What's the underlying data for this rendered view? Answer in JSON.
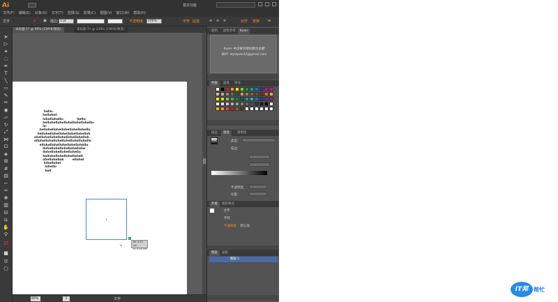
{
  "app": {
    "logo": "Ai",
    "menu": [
      "文件(F)",
      "编辑(E)",
      "对象(O)",
      "文字(T)",
      "选择(S)",
      "效果(C)",
      "视图(V)",
      "窗口(W)",
      "帮助(H)"
    ],
    "workspace": "基本功能"
  },
  "controlbar": {
    "tool_name": "文字",
    "stroke_value": "1 pt",
    "opacity_label": "不透明度:",
    "opacity_value": "100%",
    "char_label": "字符",
    "para_label": "段落",
    "transform_label": "对齐",
    "arrange_label": "变换"
  },
  "documents": {
    "tabs": [
      {
        "label": "未标题-1* @ 99% (CMYK/预览)",
        "active": true
      },
      {
        "label": "未标题-2* @ 249% (CMYK/预览)",
        "active": false
      }
    ]
  },
  "artwork": {
    "lines": [
      "           hello-",
      "          hellohel-",
      "          lohellohello-            hello-",
      "          hellohellohellohellohellohello-",
      "          lo-",
      "       hellohellohellohellohellohello",
      "     hellohellohellohellohellohelloh",
      "  ohellohellohellohellohellohelloh",
      "  ellohellohellohellohellohellohello",
      "       ellohellohellohellohellohello",
      "          llohellohellohellohellohe",
      "          llohellohellohellohello",
      "          hellohellohellohellohell",
      "          ohellohellok        ellohel",
      "           lohellohel",
      "            lohello",
      "            hell"
    ],
    "dimension_w": "W: 5.53 cm",
    "dimension_h": "H: 5.53 cm"
  },
  "statusbar": {
    "zoom": "99%",
    "page": "1",
    "mode": "文字"
  },
  "panels": {
    "kuler_tabs": [
      "颜色",
      "颜色参考",
      "Kuler"
    ],
    "kuler_line1": "Kuler 中没有可用的颜色主题",
    "kuler_line2": "帐户: stylepan12@gmail.com",
    "swatch_tabs": [
      "色板",
      "画笔",
      "符号"
    ],
    "gradient_tabs": [
      "描边",
      "渐变",
      "透明度"
    ],
    "gradient_type_label": "类型:",
    "gradient_stroke_label": "描边:",
    "opacity_label": "不透明度:",
    "position_label": "位置:",
    "appearance_tabs": [
      "外观",
      "图形样式"
    ],
    "appearance_rows": [
      "文字",
      "字符",
      "不透明度: 默认值"
    ],
    "appearance_default": "默认值",
    "layers_tabs": [
      "图层",
      "画板"
    ],
    "layer_name": "图层 1"
  },
  "swatches": [
    "#ffffff",
    "#000000",
    "#e3191c",
    "#f39a1b",
    "#f6e51b",
    "#8dc63f",
    "#00a14b",
    "#00a6a6",
    "#1b75bb",
    "#2e3192",
    "#92278f",
    "#ec008c",
    "#f7aec3",
    "#c7b299",
    "#998675",
    "#736357",
    "#534741",
    "#c69c6d",
    "#a67c52",
    "#8c6239",
    "#754c24",
    "#603813",
    "#f26522",
    "#fbb040",
    "#fff200",
    "#d7df23",
    "#8dc63f",
    "#39b54a",
    "#009444",
    "#006838",
    "#00a79d",
    "#27aae1",
    "#1c75bc",
    "#2b3990",
    "#662d91",
    "#9e1f63",
    "#ffffff",
    "#e6e6e6",
    "#cccccc",
    "#b3b3b3",
    "#999999",
    "#808080",
    "#666666",
    "#4d4d4d",
    "#333333",
    "#1a1a1a",
    "#000000",
    "#ffffff",
    "#fbb040",
    "#f7941d",
    "#ef4136",
    "#be1e2d",
    "#8b5e3c",
    "#603913",
    "#ffffff",
    "#ffffff",
    "#ffffff",
    "#ffffff",
    "#ffffff",
    "#ffffff"
  ],
  "badge": {
    "logo": "IT邦",
    "text": "帮忙"
  }
}
